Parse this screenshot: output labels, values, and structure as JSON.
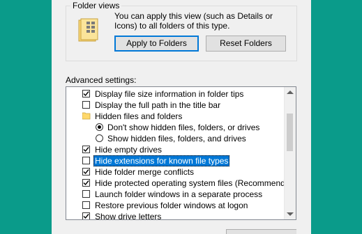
{
  "folder_views": {
    "title": "Folder views",
    "description": "You can apply this view (such as Details or Icons) to all folders of this type.",
    "apply_label": "Apply to Folders",
    "reset_label": "Reset Folders"
  },
  "advanced": {
    "label": "Advanced settings:",
    "items": [
      {
        "kind": "checkbox",
        "checked": true,
        "label": "Display file size information in folder tips"
      },
      {
        "kind": "checkbox",
        "checked": false,
        "label": "Display the full path in the title bar"
      },
      {
        "kind": "folder",
        "label": "Hidden files and folders"
      },
      {
        "kind": "radio",
        "checked": true,
        "label": "Don't show hidden files, folders, or drives"
      },
      {
        "kind": "radio",
        "checked": false,
        "label": "Show hidden files, folders, and drives"
      },
      {
        "kind": "checkbox",
        "checked": true,
        "label": "Hide empty drives"
      },
      {
        "kind": "checkbox",
        "checked": false,
        "label": "Hide extensions for known file types",
        "selected": true
      },
      {
        "kind": "checkbox",
        "checked": true,
        "label": "Hide folder merge conflicts"
      },
      {
        "kind": "checkbox",
        "checked": true,
        "label": "Hide protected operating system files (Recommended)"
      },
      {
        "kind": "checkbox",
        "checked": false,
        "label": "Launch folder windows in a separate process"
      },
      {
        "kind": "checkbox",
        "checked": false,
        "label": "Restore previous folder windows at logon"
      },
      {
        "kind": "checkbox",
        "checked": true,
        "label": "Show drive letters"
      }
    ]
  },
  "colors": {
    "desktop": "#0a9b8a",
    "dialog": "#f0f0f0",
    "selection": "#0078d7",
    "folder_icon": "#ffd86b"
  },
  "icons": {
    "folder_views": "folder-views-icon",
    "checkmark": "checkmark-icon",
    "folder": "folder-icon",
    "scroll_up": "scroll-up-arrow-icon",
    "scroll_down": "scroll-down-arrow-icon"
  }
}
